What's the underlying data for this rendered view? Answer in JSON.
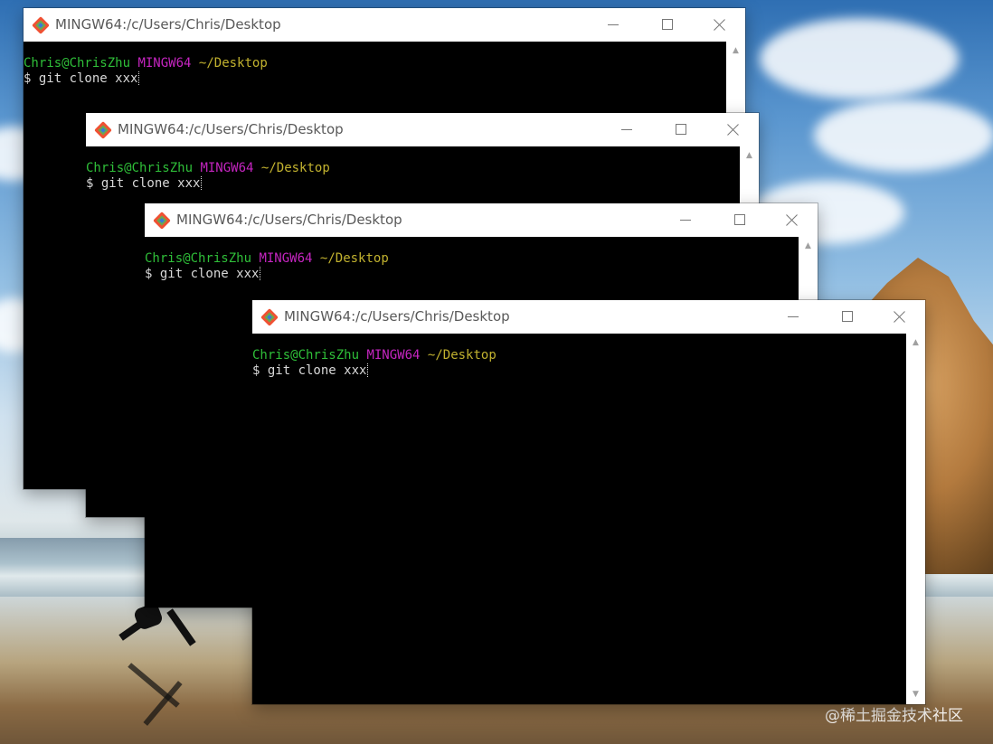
{
  "desktop": {
    "watermark": "@稀土掘金技术社区"
  },
  "windows": [
    {
      "title": "MINGW64:/c/Users/Chris/Desktop",
      "user_host": "Chris@ChrisZhu",
      "shell": "MINGW64",
      "cwd": "~/Desktop",
      "command": "$ git clone xxx"
    },
    {
      "title": "MINGW64:/c/Users/Chris/Desktop",
      "user_host": "Chris@ChrisZhu",
      "shell": "MINGW64",
      "cwd": "~/Desktop",
      "command": "$ git clone xxx"
    },
    {
      "title": "MINGW64:/c/Users/Chris/Desktop",
      "user_host": "Chris@ChrisZhu",
      "shell": "MINGW64",
      "cwd": "~/Desktop",
      "command": "$ git clone xxx"
    },
    {
      "title": "MINGW64:/c/Users/Chris/Desktop",
      "user_host": "Chris@ChrisZhu",
      "shell": "MINGW64",
      "cwd": "~/Desktop",
      "command": "$ git clone xxx"
    }
  ],
  "icons": {
    "app": "git-bash-icon",
    "minimize": "minimize-icon",
    "maximize": "maximize-icon",
    "close": "close-icon"
  },
  "colors": {
    "user": "#2fbf39",
    "shell": "#c525c0",
    "cwd": "#c2b22f",
    "text": "#d8d8d8",
    "terminal_bg": "#000000",
    "titlebar_bg": "#ffffff"
  }
}
